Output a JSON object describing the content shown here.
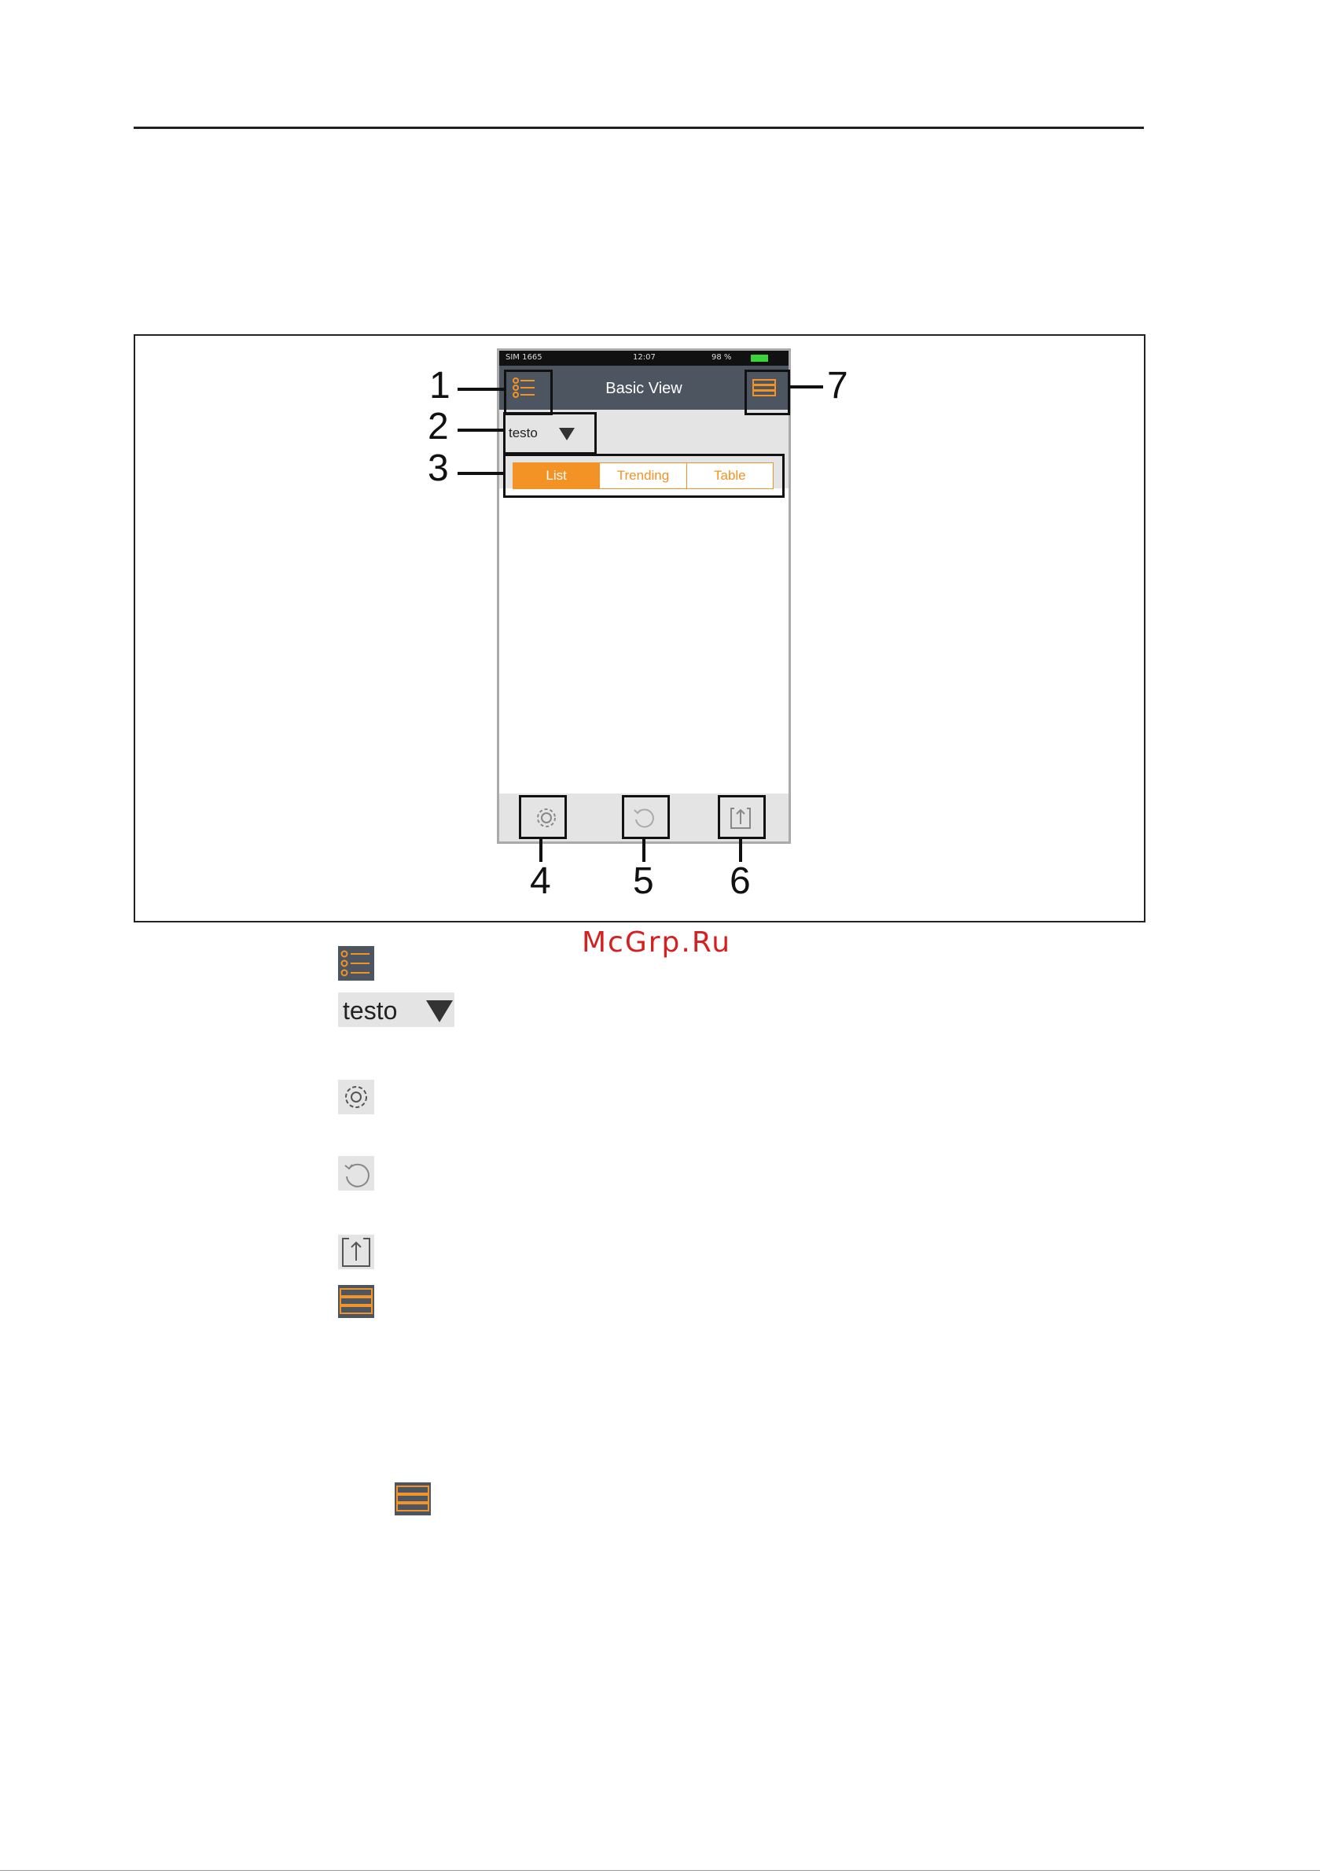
{
  "phone": {
    "status_left": "SIM 1665",
    "status_center": "12:07",
    "status_right": "98 %",
    "title": "Basic View",
    "filter_label": "testo",
    "tabs": [
      "List",
      "Trending",
      "Table"
    ]
  },
  "callouts": [
    "1",
    "2",
    "3",
    "4",
    "5",
    "6",
    "7"
  ],
  "watermark": "McGrp.Ru",
  "legend": {
    "testo_label": "testo"
  },
  "colors": {
    "accent": "#f39325",
    "titlebar": "#4d5660",
    "watermark": "#d62020"
  },
  "icons": [
    "list-menu-icon",
    "filter-dropdown-icon",
    "settings-gear-icon",
    "reset-icon",
    "export-icon",
    "bars-menu-icon"
  ]
}
